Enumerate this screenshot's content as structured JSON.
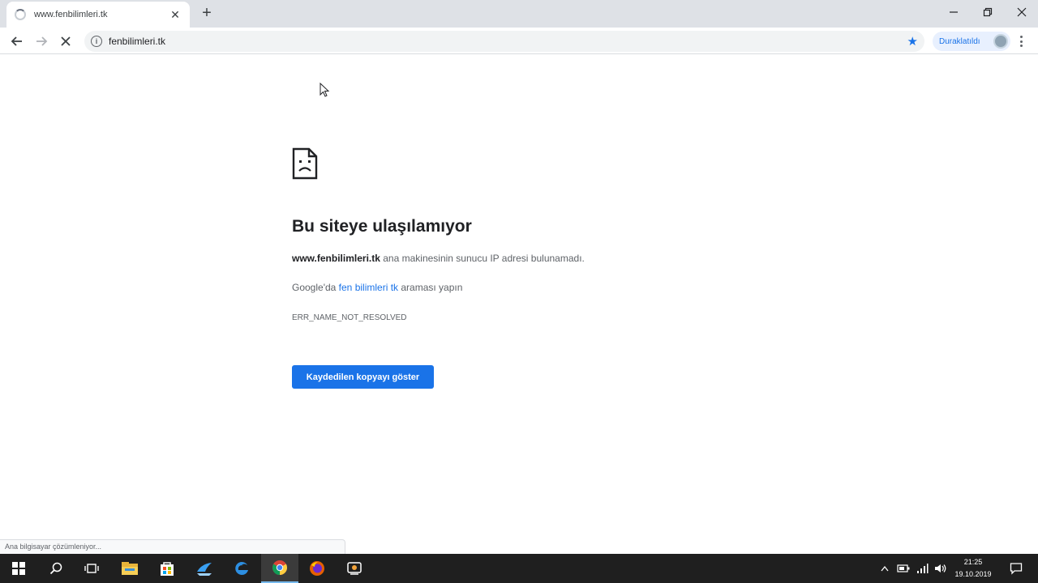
{
  "browser": {
    "tab": {
      "title": "www.fenbilimleri.tk",
      "close": "✕"
    },
    "new_tab": "+",
    "window_controls": {
      "minimize": "–",
      "maximize": "❐",
      "close": "✕"
    },
    "address_bar": {
      "url": "fenbilimleri.tk"
    },
    "profile": {
      "label": "Duraklatıldı"
    }
  },
  "error_page": {
    "title": "Bu siteye ulaşılamıyor",
    "message": {
      "host": "www.fenbilimleri.tk",
      "text": " ana makinesinin sunucu IP adresi bulunamadı."
    },
    "search": {
      "prefix": "Google'da ",
      "link": "fen bilimleri tk",
      "suffix": " araması yapın"
    },
    "error_code": "ERR_NAME_NOT_RESOLVED",
    "button_label": "Kaydedilen kopyayı göster"
  },
  "status_bar": "Ana bilgisayar çözümleniyor...",
  "taskbar": {
    "apps": [
      "start-icon",
      "search-icon",
      "task-view-icon",
      "file-explorer-icon",
      "store-icon",
      "app-icon",
      "edge-icon",
      "chrome-icon",
      "firefox-icon",
      "app-icon"
    ],
    "clock": {
      "time": "21:25",
      "date": "19.10.2019"
    }
  },
  "colors": {
    "accent": "#1a73e8",
    "tabstrip": "#dee1e6",
    "taskbar": "#1f1f1f"
  }
}
